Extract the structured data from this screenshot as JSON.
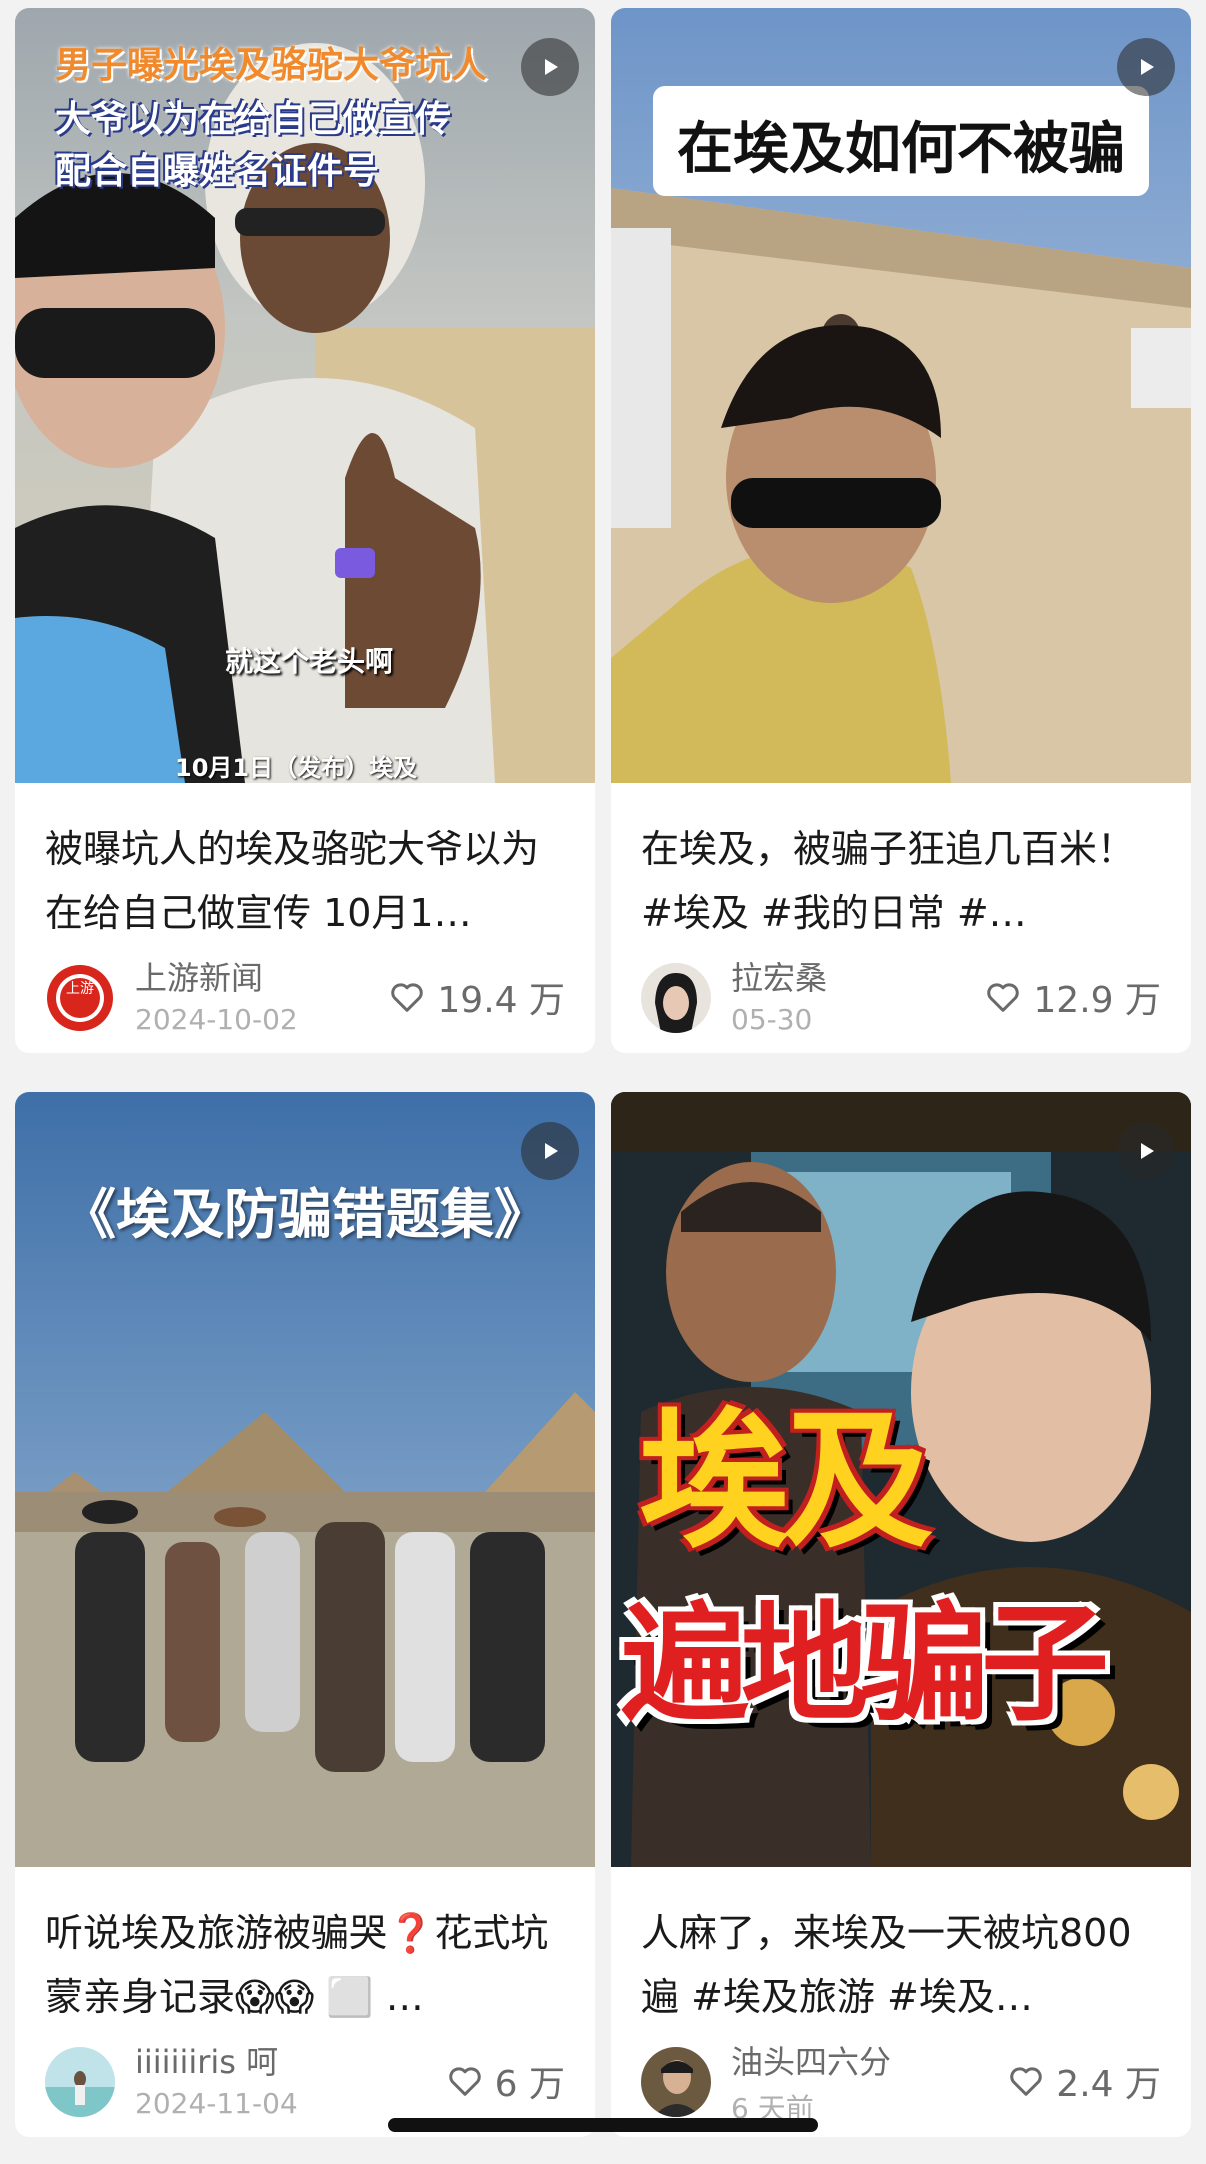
{
  "cards": [
    {
      "overlay_lines": [
        "男子曝光埃及骆驼大爷坑人",
        "大爷以为在给自己做宣传",
        "配合自曝姓名证件号"
      ],
      "subtitle": "就这个老头啊",
      "caption": "10月1日（发布）埃及",
      "title": "被曝坑人的埃及骆驼大爷以为在给自己做宣传 10月1…",
      "author": "上游新闻",
      "avatar_text": "上游",
      "date": "2024-10-02",
      "likes": "19.4 万"
    },
    {
      "overlay_lines": [
        "在埃及如何不被骗"
      ],
      "title": "在埃及，被骗子狂追几百米！ #埃及 #我的日常 #…",
      "author": "拉宏桑",
      "date": "05-30",
      "likes": "12.9 万"
    },
    {
      "overlay_lines": [
        "《埃及防骗错题集》"
      ],
      "title": "听说埃及旅游被骗哭❓花式坑蒙亲身记录😱😱 ⬜ …",
      "author": "iiiiiiiris 呵",
      "date": "2024-11-04",
      "likes": "6 万"
    },
    {
      "overlay_lines": [
        "埃及",
        "遍地骗子"
      ],
      "title": "人麻了，来埃及一天被坑800遍 #埃及旅游 #埃及…",
      "author": "油头四六分",
      "date": "6 天前",
      "likes": "2.4 万"
    }
  ],
  "icons": {
    "play": "play-icon",
    "like": "heart-outline-icon"
  },
  "colors": {
    "background": "#f2f2f2",
    "card": "#ffffff",
    "title_text": "#1a1a1a",
    "meta_text": "#6a6a6a",
    "date_text": "#b0b0b0",
    "overlay_orange": "#f08a2c",
    "overlay_red": "#e02020",
    "overlay_yellow": "#ffd21f"
  }
}
